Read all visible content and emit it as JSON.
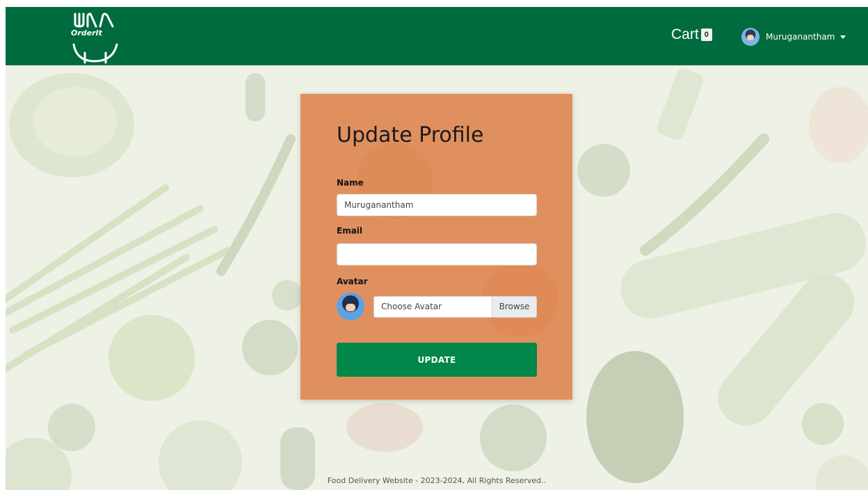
{
  "brand": {
    "logo_text": "OrderIt"
  },
  "navbar": {
    "cart_label": "Cart",
    "cart_count": "0",
    "user_name": "Muruganantham"
  },
  "form": {
    "title": "Update Profile",
    "name_label": "Name",
    "name_value": "Muruganantham",
    "email_label": "Email",
    "email_value": "",
    "avatar_label": "Avatar",
    "file_placeholder": "Choose Avatar",
    "browse_label": "Browse",
    "submit_label": "UPDATE"
  },
  "footer": {
    "text": "Food Delivery Website - 2023-2024, All Rights Reserved.."
  },
  "colors": {
    "navbar": "#006b3f",
    "card": "#dd8048",
    "button": "#008749"
  }
}
